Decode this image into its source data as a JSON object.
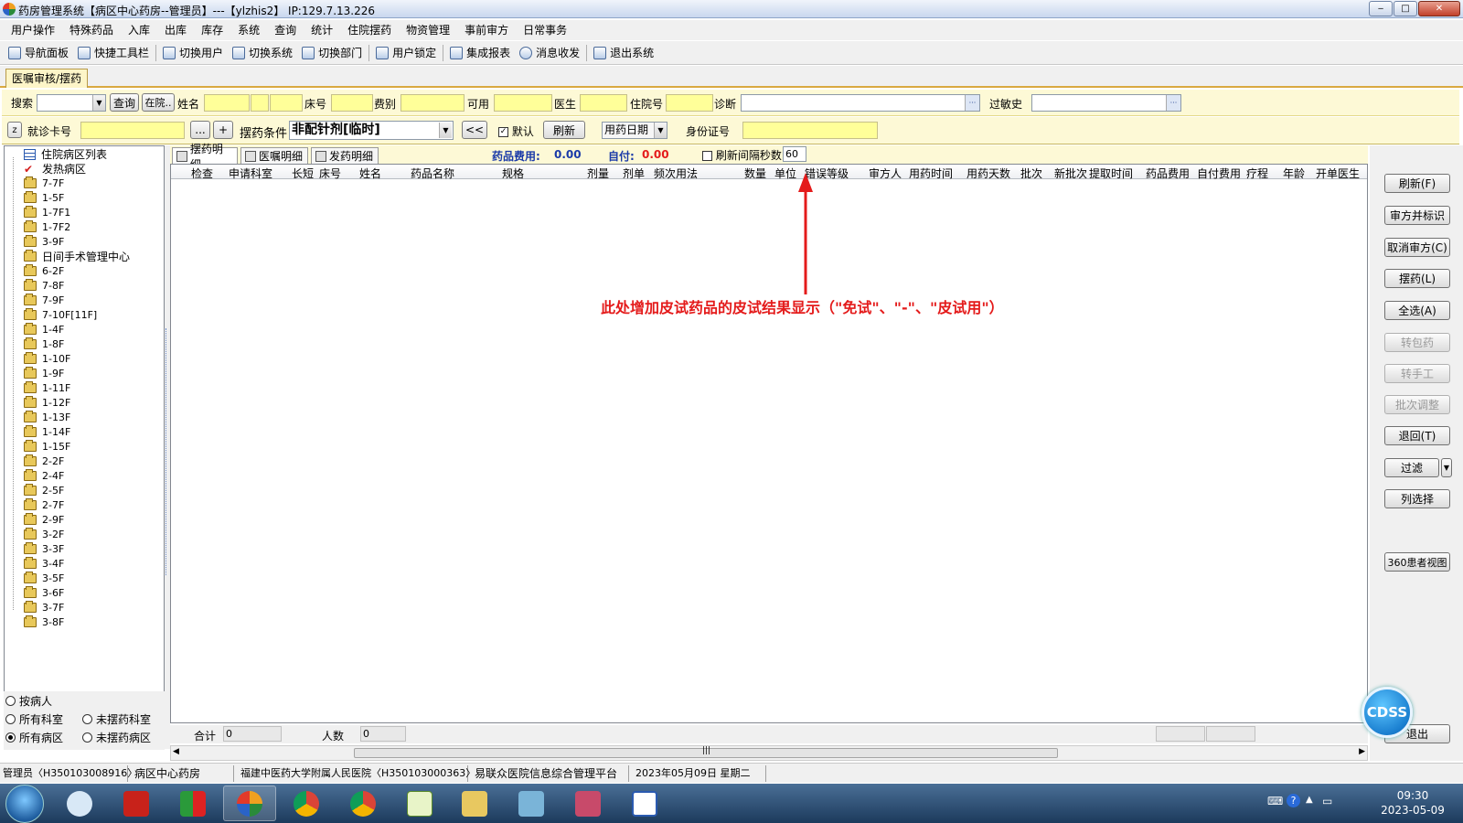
{
  "window": {
    "title": "药房管理系统【病区中心药房--管理员】---【ylzhis2】 IP:129.7.13.226",
    "min": "‒",
    "max": "□",
    "close": "✕"
  },
  "menu": [
    "用户操作",
    "特殊药品",
    "入库",
    "出库",
    "库存",
    "系统",
    "查询",
    "统计",
    "住院摆药",
    "物资管理",
    "事前审方",
    "日常事务"
  ],
  "toolbar": [
    "导航面板",
    "快捷工具栏",
    "切换用户",
    "切换系统",
    "切换部门",
    "用户锁定",
    "集成报表",
    "消息收发",
    "退出系统"
  ],
  "tab": {
    "label": "医嘱审核/摆药"
  },
  "search": {
    "search_label": "搜索",
    "query_btn": "查询",
    "inhosp_btn": "在院..",
    "name_label": "姓名",
    "bed_label": "床号",
    "fee_label": "费别",
    "avail_label": "可用",
    "doctor_label": "医生",
    "inpatient_label": "住院号",
    "diag_label": "诊断",
    "allergy_label": "过敏史",
    "ellipsis": "···"
  },
  "cond": {
    "z_btn": "z",
    "card_label": "就诊卡号",
    "dots_btn": "...",
    "plus_btn": "+",
    "cond_label": "摆药条件",
    "cond_value": "非配针剂[临时]",
    "back_btn": "<<",
    "default_label": "默认",
    "refresh_btn": "刷新",
    "date_value": "用药日期",
    "id_label": "身份证号"
  },
  "subtabs": [
    "摆药明细",
    "医嘱明细",
    "发药明细"
  ],
  "summary": {
    "fee_label": "药品费用:",
    "fee_value": "0.00",
    "self_label": "自付:",
    "self_value": "0.00",
    "refresh_interval_label": "刷新间隔秒数",
    "refresh_interval_value": "60"
  },
  "columns": [
    "检查",
    "申请科室",
    "长短",
    "床号",
    "姓名",
    "药品名称",
    "规格",
    "剂量",
    "剂单",
    "频次用法",
    "数量",
    "单位",
    "错误等级",
    "审方人",
    "用药时间",
    "用药天数",
    "批次",
    "新批次",
    "提取时间",
    "药品费用",
    "自付费用",
    "疗程",
    "年龄",
    "开单医生"
  ],
  "annotation": "此处增加皮试药品的皮试结果显示（\"免试\"、\"-\"、\"皮试用\"）",
  "tree": {
    "root": "住院病区列表",
    "items": [
      "发热病区",
      "7-7F",
      "1-5F",
      "1-7F1",
      "1-7F2",
      "3-9F",
      "日间手术管理中心",
      "6-2F",
      "7-8F",
      "7-9F",
      "7-10F[11F]",
      "1-4F",
      "1-8F",
      "1-10F",
      "1-9F",
      "1-11F",
      "1-12F",
      "1-13F",
      "1-14F",
      "1-15F",
      "2-2F",
      "2-4F",
      "2-5F",
      "2-7F",
      "2-9F",
      "3-2F",
      "3-3F",
      "3-4F",
      "3-5F",
      "3-6F",
      "3-7F",
      "3-8F"
    ]
  },
  "radios": {
    "by_patient": "按病人",
    "all_dept": "所有科室",
    "undispensed_dept": "未摆药科室",
    "all_ward": "所有病区",
    "undispensed_ward": "未摆药病区"
  },
  "footer": {
    "total_label": "合计",
    "total_value": "0",
    "count_label": "人数",
    "count_value": "0",
    "scroll_mid": "|||"
  },
  "right_buttons": [
    "刷新(F)",
    "审方并标识",
    "取消审方(C)",
    "摆药(L)",
    "全选(A)",
    "转包药",
    "转手工",
    "批次调整",
    "退回(T)",
    "过滤",
    "列选择",
    "360患者视图",
    "退出"
  ],
  "cdss": "CDSS",
  "status": {
    "user": "管理员〈H350103008916〉",
    "dept": "病区中心药房",
    "hospital": "福建中医药大学附属人民医院〈H350103000363〉",
    "platform": "易联众医院信息综合管理平台",
    "date": "2023年05月09日  星期二"
  },
  "clock": {
    "time": "09:30",
    "date": "2023-05-09"
  },
  "colors": {
    "accent_red": "#e41b1b",
    "input_yellow": "#ffff99",
    "panel_yellow": "#fdf9d6",
    "summary_blue": "#1a3aa8"
  }
}
